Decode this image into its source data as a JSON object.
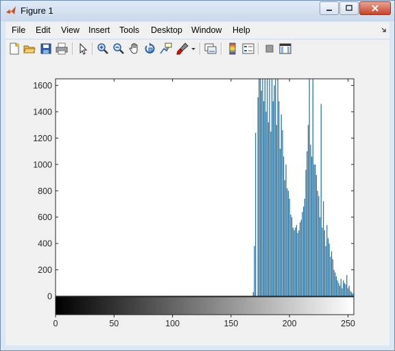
{
  "window": {
    "title": "Figure 1"
  },
  "menu": [
    {
      "label": "File"
    },
    {
      "label": "Edit"
    },
    {
      "label": "View"
    },
    {
      "label": "Insert"
    },
    {
      "label": "Tools"
    },
    {
      "label": "Desktop"
    },
    {
      "label": "Window"
    },
    {
      "label": "Help"
    }
  ],
  "toolbar": {
    "icons": [
      "new-figure-icon",
      "open-file-icon",
      "save-icon",
      "print-icon",
      "edit-plot-arrow-icon",
      "zoom-in-icon",
      "zoom-out-icon",
      "pan-hand-icon",
      "rotate-3d-icon",
      "data-cursor-icon",
      "brush-icon",
      "brush-menu-arrow-icon",
      "link-plot-icon",
      "insert-colorbar-icon",
      "insert-legend-icon",
      "hide-plot-tools-icon",
      "show-plot-tools-icon"
    ]
  },
  "colors": {
    "bar": "#1f6b99",
    "background": "#f0f0f0"
  },
  "chart_data": {
    "type": "bar",
    "title": "",
    "xlabel": "",
    "ylabel": "",
    "xlim": [
      0,
      255
    ],
    "ylim": [
      0,
      1650
    ],
    "yticks": [
      0,
      200,
      400,
      600,
      800,
      1000,
      1200,
      1400,
      1600
    ],
    "xticks": [
      0,
      50,
      100,
      150,
      200,
      250
    ],
    "colorbar": "grayscale 0-255 below axis",
    "grid": false,
    "x": [
      169,
      170,
      171,
      173,
      174,
      175,
      176,
      177,
      178,
      179,
      180,
      181,
      182,
      183,
      184,
      185,
      186,
      187,
      188,
      189,
      190,
      191,
      192,
      193,
      194,
      195,
      196,
      197,
      198,
      199,
      200,
      201,
      202,
      203,
      204,
      205,
      206,
      207,
      208,
      209,
      210,
      211,
      212,
      213,
      214,
      215,
      216,
      217,
      218,
      219,
      220,
      221,
      222,
      223,
      224,
      225,
      226,
      227,
      228,
      229,
      230,
      231,
      232,
      233,
      234,
      235,
      236,
      237,
      238,
      239,
      240,
      241,
      242,
      243,
      244,
      245,
      246,
      247,
      248,
      249,
      250,
      251,
      252,
      253,
      254,
      255
    ],
    "values": [
      30,
      380,
      1240,
      1510,
      1650,
      1650,
      1560,
      1650,
      1480,
      1650,
      1400,
      1650,
      1320,
      1650,
      1250,
      1650,
      1480,
      1600,
      1650,
      1300,
      1650,
      1480,
      1120,
      1380,
      1260,
      1060,
      880,
      1000,
      820,
      800,
      740,
      620,
      600,
      520,
      500,
      520,
      540,
      480,
      500,
      560,
      580,
      640,
      680,
      740,
      960,
      1100,
      1300,
      1650,
      1150,
      1060,
      1650,
      1000,
      1000,
      920,
      800,
      760,
      600,
      1460,
      520,
      720,
      500,
      380,
      540,
      440,
      400,
      300,
      340,
      280,
      200,
      180,
      150,
      120,
      100,
      80,
      130,
      60,
      120,
      100,
      90,
      160,
      60,
      80,
      40,
      30,
      20,
      20
    ]
  }
}
